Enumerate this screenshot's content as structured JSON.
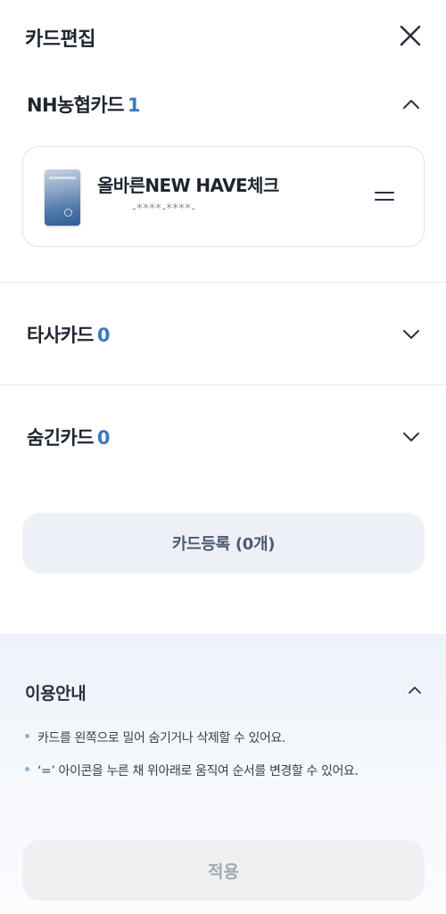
{
  "header": {
    "title": "카드편집",
    "close_icon": "close-icon"
  },
  "sections": [
    {
      "name": "NH농협카드",
      "count": "1",
      "expanded": true,
      "chevron": "chevron-up-icon"
    },
    {
      "name": "타사카드",
      "count": "0",
      "expanded": false,
      "chevron": "chevron-down-icon"
    },
    {
      "name": "숨긴카드",
      "count": "0",
      "expanded": false,
      "chevron": "chevron-down-icon"
    }
  ],
  "card": {
    "name": "올바른NEW HAVE체크",
    "number": "-****-****-",
    "handle_icon": "drag-handle-icon"
  },
  "register_button": "카드등록 (0개)",
  "guide": {
    "title": "이용안내",
    "chevron": "chevron-up-icon",
    "items": [
      "카드를 왼쪽으로 밀어 숨기거나 삭제할 수 있어요.",
      "‘=’ 아이콘을 누른 채 위아래로 움직여 순서를 변경할 수 있어요."
    ]
  },
  "apply_button": "적용",
  "colors": {
    "accent": "#3b78c1",
    "text": "#1e2430",
    "register_bg": "#edf1f7",
    "apply_bg": "#eef0f2",
    "apply_text": "#a3a8b0"
  }
}
